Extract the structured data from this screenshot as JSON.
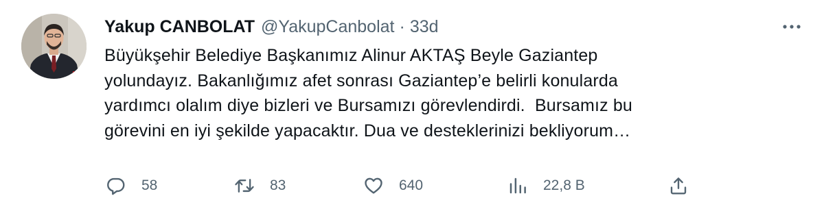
{
  "tweet": {
    "author_name": "Yakup CANBOLAT",
    "handle": "@YakupCanbolat",
    "separator": "·",
    "time": "33d",
    "text_lines": [
      "Büyükşehir Belediye Başkanımız Alinur AKTAŞ Beyle Gaziantep",
      "yolundayız. Bakanlığımız afet sonrası Gaziantep’e belirli konularda",
      "yardımcı olalım diye bizleri ve Bursamızı görevlendirdi.  Bursamız bu",
      "görevini en iyi şekilde yapacaktır. Dua ve desteklerinizi bekliyorum…"
    ]
  },
  "actions": {
    "reply": {
      "icon": "reply-icon",
      "count": "58"
    },
    "retweet": {
      "icon": "retweet-icon",
      "count": "83"
    },
    "like": {
      "icon": "heart-icon",
      "count": "640"
    },
    "views": {
      "icon": "views-icon",
      "count": "22,8 B"
    },
    "share": {
      "icon": "share-icon"
    }
  },
  "colors": {
    "text_primary": "#0f1419",
    "text_secondary": "#536471",
    "background": "#ffffff"
  }
}
